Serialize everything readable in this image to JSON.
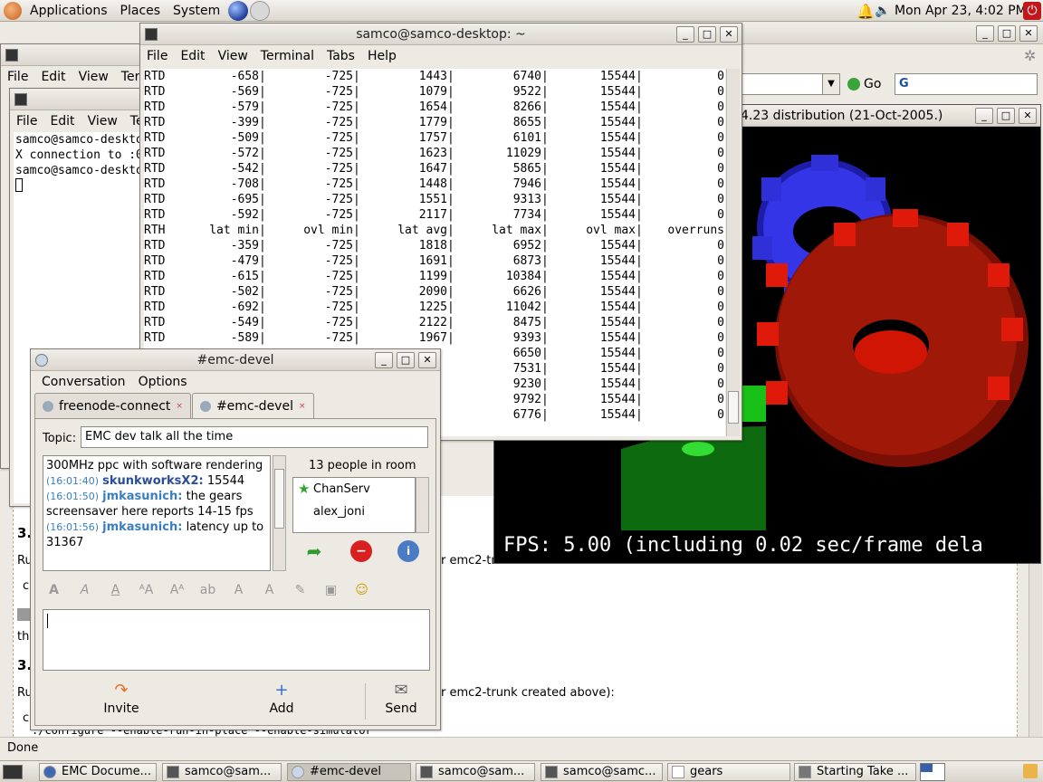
{
  "top_panel": {
    "menus": [
      "Applications",
      "Places",
      "System"
    ],
    "clock": "Mon Apr 23,  4:02 PM"
  },
  "browser": {
    "go_label": "Go",
    "gears_title": "4.23 distribution (21-Oct-2005.)",
    "status": "Done",
    "doc_lines": [
      "3.",
      "Ru",
      "c",
      "th",
      "3.",
      "Ru",
      "c",
      "r emc2-trunk created above):",
      "./configure --enable-run-in-place --enable-simulator",
      "r emc2-tru"
    ]
  },
  "back_terminal": {
    "menus": [
      "File",
      "Edit",
      "View",
      "Term"
    ],
    "menus2": [
      "File",
      "Edit",
      "View",
      "Ter"
    ],
    "lines": [
      "samco@samco-deskto",
      "X connection to :0",
      "samco@samco-deskto"
    ]
  },
  "terminal": {
    "title": "samco@samco-desktop: ~",
    "menus": [
      "File",
      "Edit",
      "View",
      "Terminal",
      "Tabs",
      "Help"
    ],
    "rows": [
      [
        "RTD",
        "-658",
        "-725",
        "1443",
        "6740",
        "15544",
        "0"
      ],
      [
        "RTD",
        "-569",
        "-725",
        "1079",
        "9522",
        "15544",
        "0"
      ],
      [
        "RTD",
        "-579",
        "-725",
        "1654",
        "8266",
        "15544",
        "0"
      ],
      [
        "RTD",
        "-399",
        "-725",
        "1779",
        "8655",
        "15544",
        "0"
      ],
      [
        "RTD",
        "-509",
        "-725",
        "1757",
        "6101",
        "15544",
        "0"
      ],
      [
        "RTD",
        "-572",
        "-725",
        "1623",
        "11029",
        "15544",
        "0"
      ],
      [
        "RTD",
        "-542",
        "-725",
        "1647",
        "5865",
        "15544",
        "0"
      ],
      [
        "RTD",
        "-708",
        "-725",
        "1448",
        "7946",
        "15544",
        "0"
      ],
      [
        "RTD",
        "-695",
        "-725",
        "1551",
        "9313",
        "15544",
        "0"
      ],
      [
        "RTD",
        "-592",
        "-725",
        "2117",
        "7734",
        "15544",
        "0"
      ],
      [
        "RTH",
        "lat min",
        "ovl min",
        "lat avg",
        "lat max",
        "ovl max",
        "overruns"
      ],
      [
        "RTD",
        "-359",
        "-725",
        "1818",
        "6952",
        "15544",
        "0"
      ],
      [
        "RTD",
        "-479",
        "-725",
        "1691",
        "6873",
        "15544",
        "0"
      ],
      [
        "RTD",
        "-615",
        "-725",
        "1199",
        "10384",
        "15544",
        "0"
      ],
      [
        "RTD",
        "-502",
        "-725",
        "2090",
        "6626",
        "15544",
        "0"
      ],
      [
        "RTD",
        "-692",
        "-725",
        "1225",
        "11042",
        "15544",
        "0"
      ],
      [
        "RTD",
        "-549",
        "-725",
        "2122",
        "8475",
        "15544",
        "0"
      ],
      [
        "RTD",
        "-589",
        "-725",
        "1967",
        "9393",
        "15544",
        "0"
      ],
      [
        "",
        "",
        "",
        "",
        "6650",
        "15544",
        "0"
      ],
      [
        "",
        "",
        "",
        "",
        "7531",
        "15544",
        "0"
      ],
      [
        "",
        "",
        "",
        "",
        "9230",
        "15544",
        "0"
      ],
      [
        "",
        "",
        "",
        "",
        "9792",
        "15544",
        "0"
      ],
      [
        "",
        "",
        "",
        "",
        "6776",
        "15544",
        "0"
      ]
    ]
  },
  "gears": {
    "fps_text": "FPS:  5.00  (including 0.02 sec/frame dela"
  },
  "gaim": {
    "title": "#emc-devel",
    "menus": [
      "Conversation",
      "Options"
    ],
    "tabs": [
      "freenode-connect",
      "#emc-devel"
    ],
    "topic_label": "Topic:",
    "topic": "EMC dev talk all the time",
    "chat": [
      {
        "ts": "",
        "nick": "",
        "text": "300MHz ppc with software rendering"
      },
      {
        "ts": "(16:01:40)",
        "nick": "skunkworksX2:",
        "text": "15544"
      },
      {
        "ts": "(16:01:50)",
        "nick": "jmkasunich:",
        "text": "the gears screensaver here reports 14-15 fps"
      },
      {
        "ts": "(16:01:56)",
        "nick": "jmkasunich:",
        "text": "latency up to 31367"
      }
    ],
    "people_count": "13 people in room",
    "people": [
      "ChanServ",
      "alex_joni",
      "..."
    ],
    "buttons": {
      "invite": "Invite",
      "add": "Add",
      "send": "Send"
    }
  },
  "taskbar": {
    "items": [
      "EMC Docume...",
      "samco@sam...",
      "#emc-devel",
      "samco@sam...",
      "samco@samc...",
      "gears",
      "Starting Take ..."
    ]
  }
}
